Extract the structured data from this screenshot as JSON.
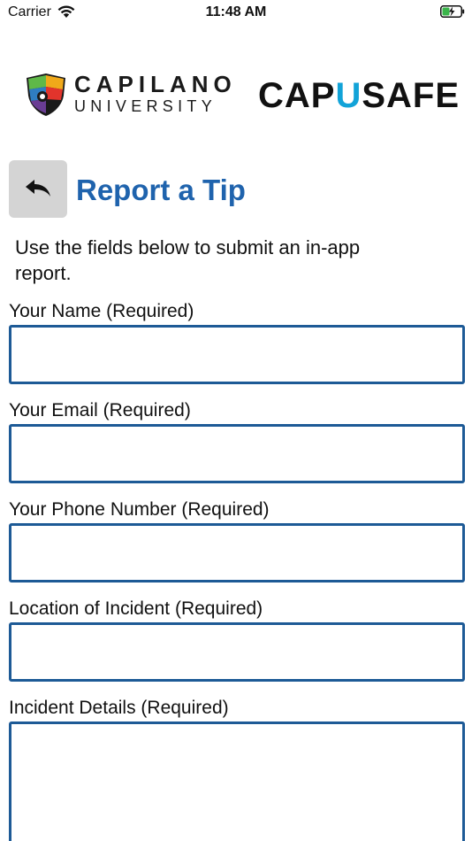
{
  "status_bar": {
    "carrier": "Carrier",
    "time": "11:48 AM",
    "wifi_icon": "wifi-icon",
    "battery_icon": "battery-charging-icon"
  },
  "logos": {
    "capilano_line1": "CAPILANO",
    "capilano_line2": "UNIVERSITY",
    "capusafe_cap": "CAP",
    "capusafe_u": "U",
    "capusafe_safe": "SAFE",
    "colors": {
      "u_accent": "#12a3d8"
    }
  },
  "header": {
    "back_icon": "reply-arrow-icon",
    "title": "Report a Tip",
    "title_color": "#1f63ad"
  },
  "intro": "Use the fields below to submit an in-app report.",
  "fields": [
    {
      "label": "Your Name (Required)",
      "value": ""
    },
    {
      "label": "Your Email (Required)",
      "value": ""
    },
    {
      "label": "Your Phone Number (Required)",
      "value": ""
    },
    {
      "label": "Location of Incident (Required)",
      "value": ""
    },
    {
      "label": "Incident Details (Required)",
      "value": ""
    }
  ],
  "colors": {
    "field_border": "#1d5a96",
    "back_button_bg": "#d4d4d4"
  }
}
